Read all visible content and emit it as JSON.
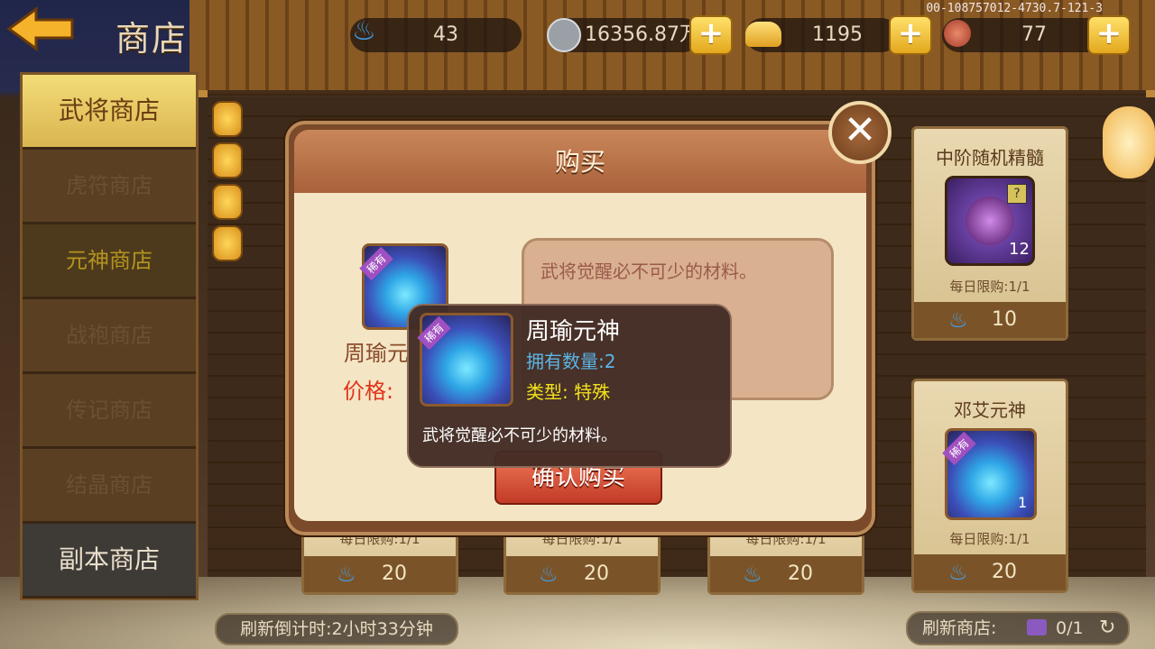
{
  "top_bar": {
    "title": "商店",
    "build_id": "00-108757012-4730.7-121-3",
    "resources": [
      {
        "icon": "blue-flame-icon",
        "value": "43"
      },
      {
        "icon": "coin-icon",
        "value": "16356.87万"
      },
      {
        "icon": "gold-ingot-icon",
        "value": "1195"
      },
      {
        "icon": "meat-icon",
        "value": "77"
      }
    ]
  },
  "sidebar": {
    "items": [
      {
        "label": "武将商店"
      },
      {
        "label": "虎符商店"
      },
      {
        "label": "元神商店"
      },
      {
        "label": "战袍商店"
      },
      {
        "label": "传记商店"
      },
      {
        "label": "结晶商店"
      },
      {
        "label": "副本商店"
      }
    ]
  },
  "shop_cards": {
    "right_top": {
      "title": "中阶随机精髓",
      "count": "12",
      "limit": "每日限购:1/1",
      "price": "10"
    },
    "right_mid": {
      "title": "邓艾元神",
      "rare": "稀有",
      "count": "1",
      "limit": "每日限购:1/1",
      "price": "20"
    },
    "bottom": [
      {
        "limit": "每日限购:1/1",
        "price": "20"
      },
      {
        "limit": "每日限购:1/1",
        "price": "20"
      },
      {
        "limit": "每日限购:1/1",
        "price": "20"
      }
    ]
  },
  "modal": {
    "title": "购买",
    "item_name_partial": "周瑜元",
    "price_label": "价格:",
    "rare": "稀有",
    "description": "武将觉醒必不可少的材料。",
    "confirm_label": "确认购买"
  },
  "tooltip": {
    "name": "周瑜元神",
    "rare": "稀有",
    "owned": "拥有数量:2",
    "type": "类型: 特殊",
    "description": "武将觉醒必不可少的材料。"
  },
  "bottom": {
    "countdown": "刷新倒计时:2小时33分钟",
    "refresh_label": "刷新商店:",
    "refresh_count": "0/1"
  }
}
